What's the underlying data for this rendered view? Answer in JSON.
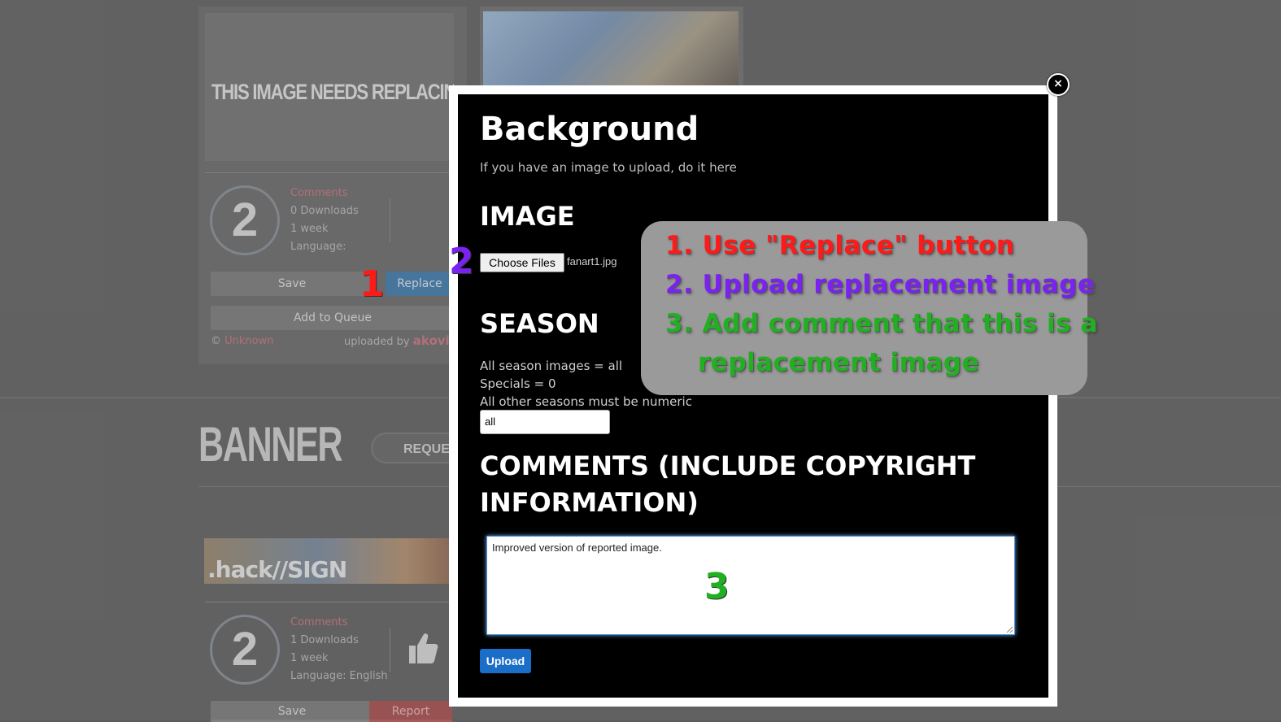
{
  "background_page": {
    "card1": {
      "placeholder_text": "THIS IMAGE NEEDS REPLACING",
      "count": "2",
      "comments_link": "Comments",
      "downloads": "0 Downloads",
      "age": "1 week",
      "language": "Language:",
      "save_label": "Save",
      "replace_label": "Replace",
      "queue_label": "Add to Queue",
      "copyright_prefix": "©",
      "copyright_owner": "Unknown",
      "uploaded_by_label": "uploaded by",
      "uploader": "akovia"
    },
    "banner_section": {
      "heading": "BANNER",
      "request_label": "REQUEST"
    },
    "card3": {
      "thumb_text": ".hack//SIGN",
      "count": "2",
      "comments_link": "Comments",
      "downloads": "1 Downloads",
      "age": "1 week",
      "language": "Language: English",
      "save_label": "Save",
      "report_label": "Report"
    }
  },
  "modal": {
    "title": "Background",
    "subtitle": "If you have an image to upload, do it here",
    "close_symbol": "×",
    "image_section": {
      "heading": "IMAGE",
      "file_button_label": "Choose Files",
      "file_name": "fanart1.jpg"
    },
    "season_section": {
      "heading": "SEASON",
      "help_lines": [
        "All season images = all",
        "Specials = 0",
        "All other seasons must be numeric"
      ],
      "value": "all"
    },
    "comments_section": {
      "heading_line1": "COMMENTS (INCLUDE COPYRIGHT",
      "heading_line2": "INFORMATION)",
      "value": "Improved version of reported image."
    },
    "upload_label": "Upload"
  },
  "annotations": {
    "steps": [
      {
        "text": "1. Use \"Replace\" button",
        "color": "#ff1a1a"
      },
      {
        "text": "2. Upload replacement image",
        "color": "#7a22f0"
      },
      {
        "text": "3. Add comment that this is a",
        "color": "#22b022"
      },
      {
        "text": "replacement image",
        "color": "#22b022"
      }
    ],
    "markers": {
      "one": "1",
      "two": "2",
      "three": "3"
    }
  },
  "colors": {
    "modal_bg": "#000000",
    "modal_border": "#ffffff",
    "upload_button": "#1a6ec8",
    "callout_bg": "#9a9a9a"
  }
}
